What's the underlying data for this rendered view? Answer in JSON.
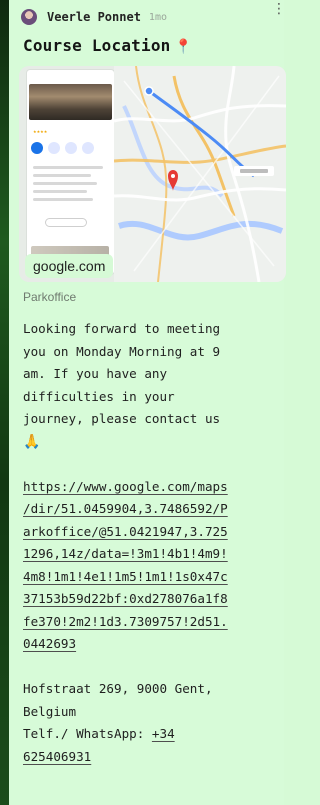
{
  "post": {
    "author": "Veerle Ponnet",
    "time": "1mo",
    "title": "Course Location"
  },
  "link_preview": {
    "source_label": "google.com",
    "place_name": "Parkoffice"
  },
  "message": {
    "intro_lines": [
      "Looking forward to meeting",
      "you on Monday Morning at 9",
      "am. If you have any",
      "difficulties in your",
      "journey, please contact us"
    ],
    "url_lines": [
      "https://www.google.com/maps",
      "/dir/51.0459904,3.7486592/P",
      "arkoffice/@51.0421947,3.725",
      "1296,14z/data=!3m1!4b1!4m9!",
      "4m8!1m1!4e1!1m5!1m1!1s0x47c",
      "37153b59d22bf:0xd278076a1f8",
      "fe370!2m2!1d3.7309757!2d51.",
      "0442693"
    ],
    "address_lines": [
      "Hofstraat 269, 9000 Gent,",
      "Belgium"
    ],
    "contact_label": "Telf./ WhatsApp: ",
    "phone_part1": "+34",
    "phone_part2": "625406931"
  },
  "icons": {
    "title_icon": "pin-icon",
    "emoji": "praying-hands-icon"
  },
  "colors": {
    "background": "#d6fad6",
    "side_strip": "#1f5a1f",
    "pin": "#e53935"
  }
}
